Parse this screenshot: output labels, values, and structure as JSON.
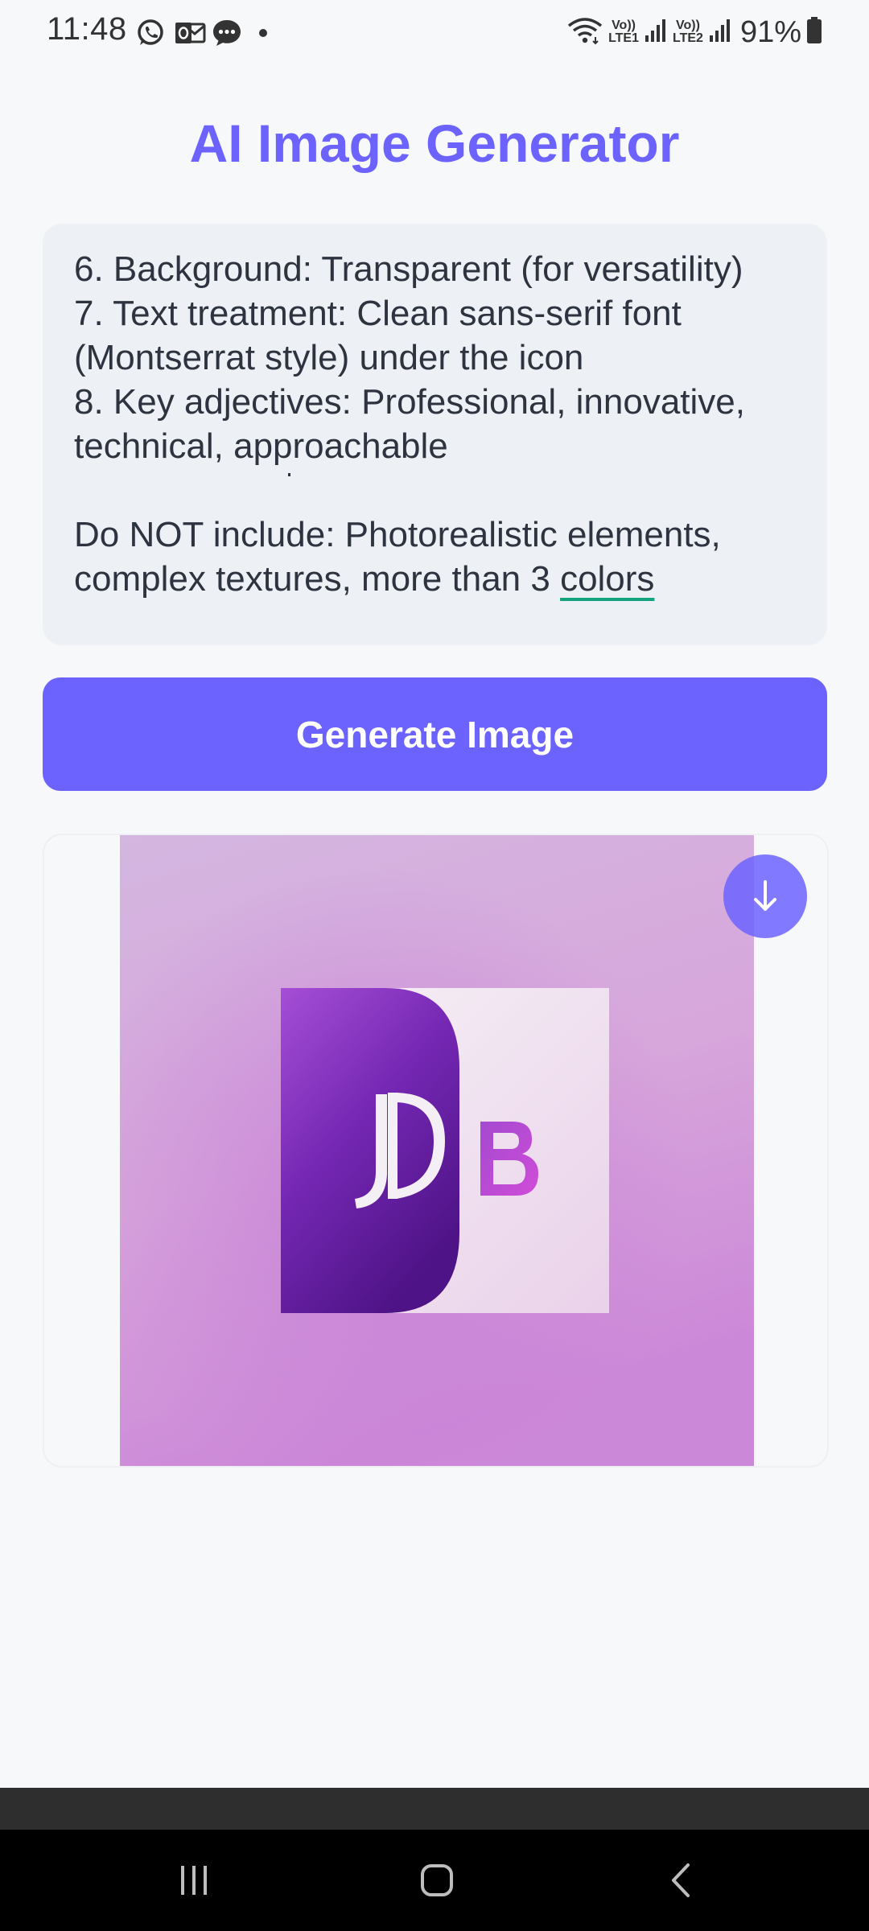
{
  "status_bar": {
    "time": "11:48",
    "notification_icons": [
      "whatsapp-icon",
      "outlook-icon",
      "messages-icon"
    ],
    "sim1_label_top": "Vo))",
    "sim1_label_bottom": "LTE1",
    "sim2_label_top": "Vo))",
    "sim2_label_bottom": "LTE2",
    "battery": "91%"
  },
  "header": {
    "title": "AI Image Generator"
  },
  "prompt": {
    "text": "6. Background: Transparent (for versatility)\n7. Text treatment: Clean sans-serif font (Montserrat style) under the icon\n8. Key adjectives: Professional, innovative, technical, approachable\n\nDo NOT include: Photorealistic elements, complex textures, more than 3 ",
    "underlined_word": "colors"
  },
  "generate_button": {
    "label": "Generate Image"
  },
  "result": {
    "logo_letters": "JDB",
    "download_icon": "download-arrow-icon"
  },
  "navigation": {
    "icons": [
      "recent-apps-icon",
      "home-icon",
      "back-icon"
    ]
  },
  "colors": {
    "accent": "#6c63ff",
    "prompt_background": "#edf1f5",
    "page_background": "#f7f8fa",
    "spellcheck_underline": "#13a37d"
  }
}
